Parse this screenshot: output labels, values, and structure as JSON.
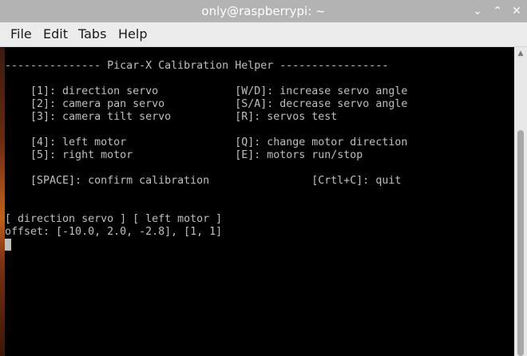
{
  "window": {
    "title": "only@raspberrypi: ~",
    "minimize_glyph": "⌄",
    "maximize_glyph": "⌃",
    "close_glyph": "✕"
  },
  "menubar": {
    "file": "File",
    "edit": "Edit",
    "tabs": "Tabs",
    "help": "Help"
  },
  "terminal": {
    "lines": [
      "--------------- Picar-X Calibration Helper -----------------",
      "",
      "    [1]: direction servo            [W/D]: increase servo angle",
      "    [2]: camera pan servo           [S/A]: decrease servo angle",
      "    [3]: camera tilt servo          [R]: servos test",
      "",
      "    [4]: left motor                 [Q]: change motor direction",
      "    [5]: right motor                [E]: motors run/stop",
      "",
      "    [SPACE]: confirm calibration                [Crtl+C]: quit",
      "",
      "",
      "[ direction servo ] [ left motor ]",
      "offset: [-10.0, 2.0, -2.8], [1, 1]"
    ]
  },
  "scrollbar": {
    "up_glyph": "▲"
  }
}
